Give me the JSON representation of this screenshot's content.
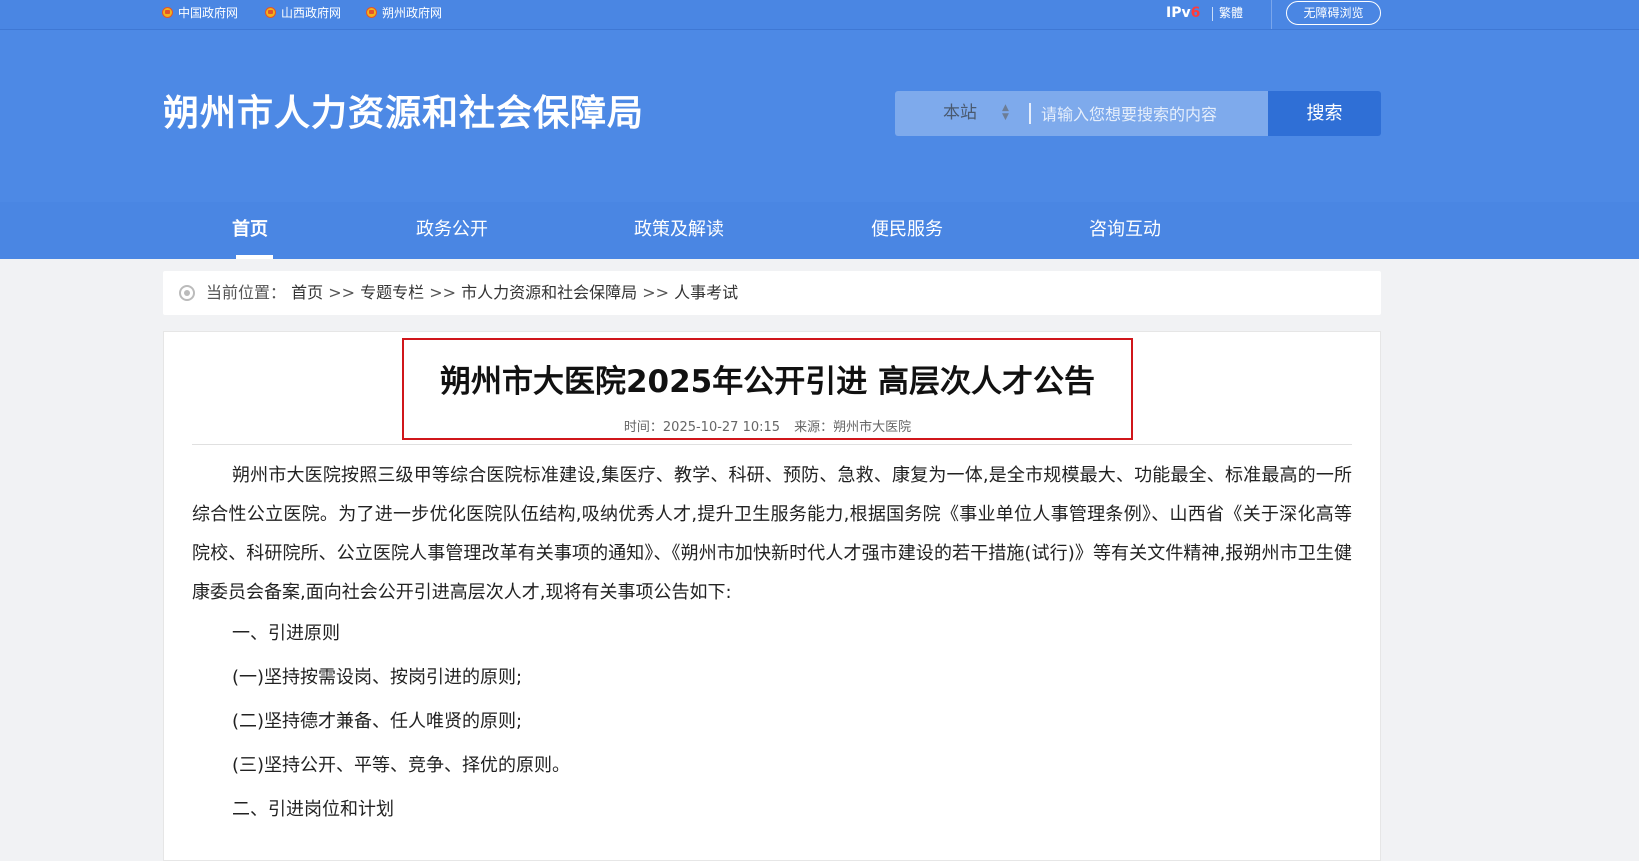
{
  "topbar": {
    "links": [
      "中国政府网",
      "山西政府网",
      "朔州政府网"
    ],
    "ipv6_prefix": "IPv",
    "ipv6_suffix": "6",
    "traditional": "繁體",
    "accessibility": "无障碍浏览"
  },
  "header": {
    "site_title": "朔州市人力资源和社会保障局",
    "search_scope": "本站",
    "search_placeholder": "请输入您想要搜索的内容",
    "search_button": "搜索"
  },
  "nav": {
    "items": [
      "首页",
      "政务公开",
      "政策及解读",
      "便民服务",
      "咨询互动"
    ],
    "active_index": 0
  },
  "breadcrumb": {
    "label": "当前位置：",
    "items": [
      "首页",
      "专题专栏",
      "市人力资源和社会保障局",
      "人事考试"
    ],
    "separator": ">>"
  },
  "article": {
    "title": "朔州市大医院2025年公开引进 高层次人才公告",
    "time_label": "时间：",
    "time": "2025-10-27 10:15",
    "source_label": "来源：",
    "source": "朔州市大医院",
    "intro": "朔州市大医院按照三级甲等综合医院标准建设,集医疗、教学、科研、预防、急救、康复为一体,是全市规模最大、功能最全、标准最高的一所综合性公立医院。为了进一步优化医院队伍结构,吸纳优秀人才,提升卫生服务能力,根据国务院《事业单位人事管理条例》、山西省《关于深化高等院校、科研院所、公立医院人事管理改革有关事项的通知》、《朔州市加快新时代人才强市建设的若干措施(试行)》等有关文件精神,报朔州市卫生健康委员会备案,面向社会公开引进高层次人才,现将有关事项公告如下:",
    "lines": [
      "一、引进原则",
      "(一)坚持按需设岗、按岗引进的原则;",
      "(二)坚持德才兼备、任人唯贤的原则;",
      "(三)坚持公开、平等、竞争、择优的原则。",
      "二、引进岗位和计划"
    ]
  },
  "colors": {
    "primary_blue": "#4d89e5",
    "search_button_blue": "#2f6fd6",
    "highlight_red": "#d0161b",
    "ipv6_red": "#ff3b3b"
  }
}
